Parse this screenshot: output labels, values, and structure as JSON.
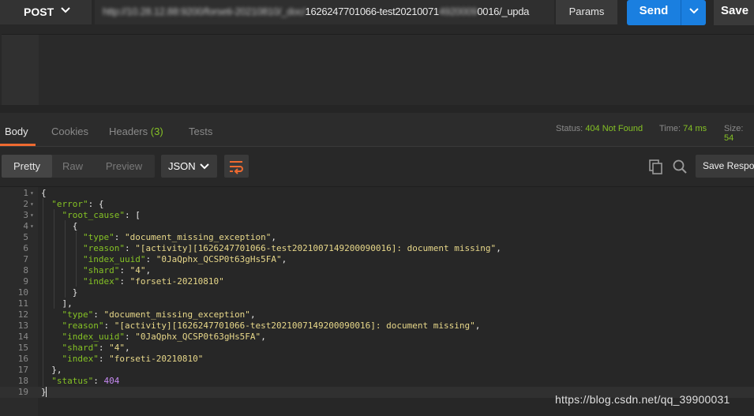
{
  "request": {
    "method": "POST",
    "url_obscured_prefix": "http://10.28.12.88:9200/forseti-20210810/_doc/",
    "url_tail": "1626247701066-test20210071",
    "url_obscured_mid": "4920009",
    "url_end": "0016/_upda",
    "params_label": "Params",
    "send_label": "Send",
    "save_label": "Save"
  },
  "response_tabs": [
    {
      "label": "Body",
      "active": true
    },
    {
      "label": "Cookies",
      "active": false
    },
    {
      "label": "Headers",
      "count": "(3)",
      "active": false
    },
    {
      "label": "Tests",
      "active": false
    }
  ],
  "response_meta": {
    "status_key": "Status:",
    "status_value": "404 Not Found",
    "time_key": "Time:",
    "time_value": "74 ms",
    "size_key": "Size:",
    "size_value": "54"
  },
  "view_modes": [
    {
      "label": "Pretty",
      "active": true
    },
    {
      "label": "Raw",
      "active": false
    },
    {
      "label": "Preview",
      "active": false
    }
  ],
  "format_select": "JSON",
  "save_response_label": "Save Response",
  "icons": {
    "method_chevron": "chevron-down-icon",
    "send_dropdown": "chevron-down-icon",
    "wrap": "wrap-lines-icon",
    "copy": "copy-icon",
    "search": "search-icon"
  },
  "colors": {
    "accent": "#ef6a30",
    "send": "#1a7fe0",
    "status_ok_green": "#85c225",
    "json_key": "#85c225",
    "json_string": "#e8d88a",
    "json_number": "#c68af2"
  },
  "code_lines": [
    {
      "n": "1",
      "fold": "▾",
      "tokens": [
        [
          "p",
          "{"
        ]
      ]
    },
    {
      "n": "2",
      "fold": "▾",
      "tokens": [
        [
          "p",
          "  "
        ],
        [
          "k",
          "\"error\""
        ],
        [
          "p",
          ": {"
        ]
      ]
    },
    {
      "n": "3",
      "fold": "▾",
      "tokens": [
        [
          "p",
          "    "
        ],
        [
          "k",
          "\"root_cause\""
        ],
        [
          "p",
          ": ["
        ]
      ]
    },
    {
      "n": "4",
      "fold": "▾",
      "tokens": [
        [
          "p",
          "      {"
        ]
      ]
    },
    {
      "n": "5",
      "fold": "",
      "tokens": [
        [
          "p",
          "        "
        ],
        [
          "k",
          "\"type\""
        ],
        [
          "p",
          ": "
        ],
        [
          "s",
          "\"document_missing_exception\""
        ],
        [
          "p",
          ","
        ]
      ]
    },
    {
      "n": "6",
      "fold": "",
      "tokens": [
        [
          "p",
          "        "
        ],
        [
          "k",
          "\"reason\""
        ],
        [
          "p",
          ": "
        ],
        [
          "s",
          "\"[activity][1626247701066-test2021007149200090016]: document missing\""
        ],
        [
          "p",
          ","
        ]
      ]
    },
    {
      "n": "7",
      "fold": "",
      "tokens": [
        [
          "p",
          "        "
        ],
        [
          "k",
          "\"index_uuid\""
        ],
        [
          "p",
          ": "
        ],
        [
          "s",
          "\"0JaQphx_QCSP0t63gHs5FA\""
        ],
        [
          "p",
          ","
        ]
      ]
    },
    {
      "n": "8",
      "fold": "",
      "tokens": [
        [
          "p",
          "        "
        ],
        [
          "k",
          "\"shard\""
        ],
        [
          "p",
          ": "
        ],
        [
          "s",
          "\"4\""
        ],
        [
          "p",
          ","
        ]
      ]
    },
    {
      "n": "9",
      "fold": "",
      "tokens": [
        [
          "p",
          "        "
        ],
        [
          "k",
          "\"index\""
        ],
        [
          "p",
          ": "
        ],
        [
          "s",
          "\"forseti-20210810\""
        ]
      ]
    },
    {
      "n": "10",
      "fold": "",
      "tokens": [
        [
          "p",
          "      }"
        ]
      ]
    },
    {
      "n": "11",
      "fold": "",
      "tokens": [
        [
          "p",
          "    ],"
        ]
      ]
    },
    {
      "n": "12",
      "fold": "",
      "tokens": [
        [
          "p",
          "    "
        ],
        [
          "k",
          "\"type\""
        ],
        [
          "p",
          ": "
        ],
        [
          "s",
          "\"document_missing_exception\""
        ],
        [
          "p",
          ","
        ]
      ]
    },
    {
      "n": "13",
      "fold": "",
      "tokens": [
        [
          "p",
          "    "
        ],
        [
          "k",
          "\"reason\""
        ],
        [
          "p",
          ": "
        ],
        [
          "s",
          "\"[activity][1626247701066-test2021007149200090016]: document missing\""
        ],
        [
          "p",
          ","
        ]
      ]
    },
    {
      "n": "14",
      "fold": "",
      "tokens": [
        [
          "p",
          "    "
        ],
        [
          "k",
          "\"index_uuid\""
        ],
        [
          "p",
          ": "
        ],
        [
          "s",
          "\"0JaQphx_QCSP0t63gHs5FA\""
        ],
        [
          "p",
          ","
        ]
      ]
    },
    {
      "n": "15",
      "fold": "",
      "tokens": [
        [
          "p",
          "    "
        ],
        [
          "k",
          "\"shard\""
        ],
        [
          "p",
          ": "
        ],
        [
          "s",
          "\"4\""
        ],
        [
          "p",
          ","
        ]
      ]
    },
    {
      "n": "16",
      "fold": "",
      "tokens": [
        [
          "p",
          "    "
        ],
        [
          "k",
          "\"index\""
        ],
        [
          "p",
          ": "
        ],
        [
          "s",
          "\"forseti-20210810\""
        ]
      ]
    },
    {
      "n": "17",
      "fold": "",
      "tokens": [
        [
          "p",
          "  },"
        ]
      ]
    },
    {
      "n": "18",
      "fold": "",
      "tokens": [
        [
          "p",
          "  "
        ],
        [
          "k",
          "\"status\""
        ],
        [
          "p",
          ": "
        ],
        [
          "n",
          "404"
        ]
      ]
    },
    {
      "n": "19",
      "fold": "",
      "tokens": [
        [
          "p",
          "}"
        ]
      ]
    }
  ],
  "watermark": "https://blog.csdn.net/qq_39900031"
}
